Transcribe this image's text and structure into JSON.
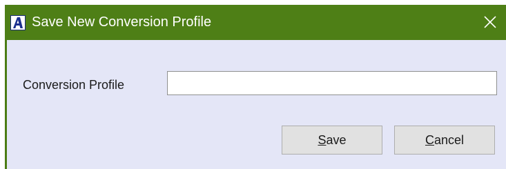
{
  "dialog": {
    "title": "Save New Conversion Profile",
    "app_icon_letter": "A",
    "close_icon": "close-icon",
    "colors": {
      "titlebar": "#4e7f16",
      "client_background": "#e4e6f7",
      "button_face": "#e1e1e1"
    }
  },
  "form": {
    "profile_label": "Conversion Profile",
    "profile_value": "",
    "profile_placeholder": ""
  },
  "buttons": {
    "save": {
      "mnemonic": "S",
      "rest": "ave"
    },
    "cancel": {
      "mnemonic": "C",
      "rest": "ancel"
    }
  }
}
